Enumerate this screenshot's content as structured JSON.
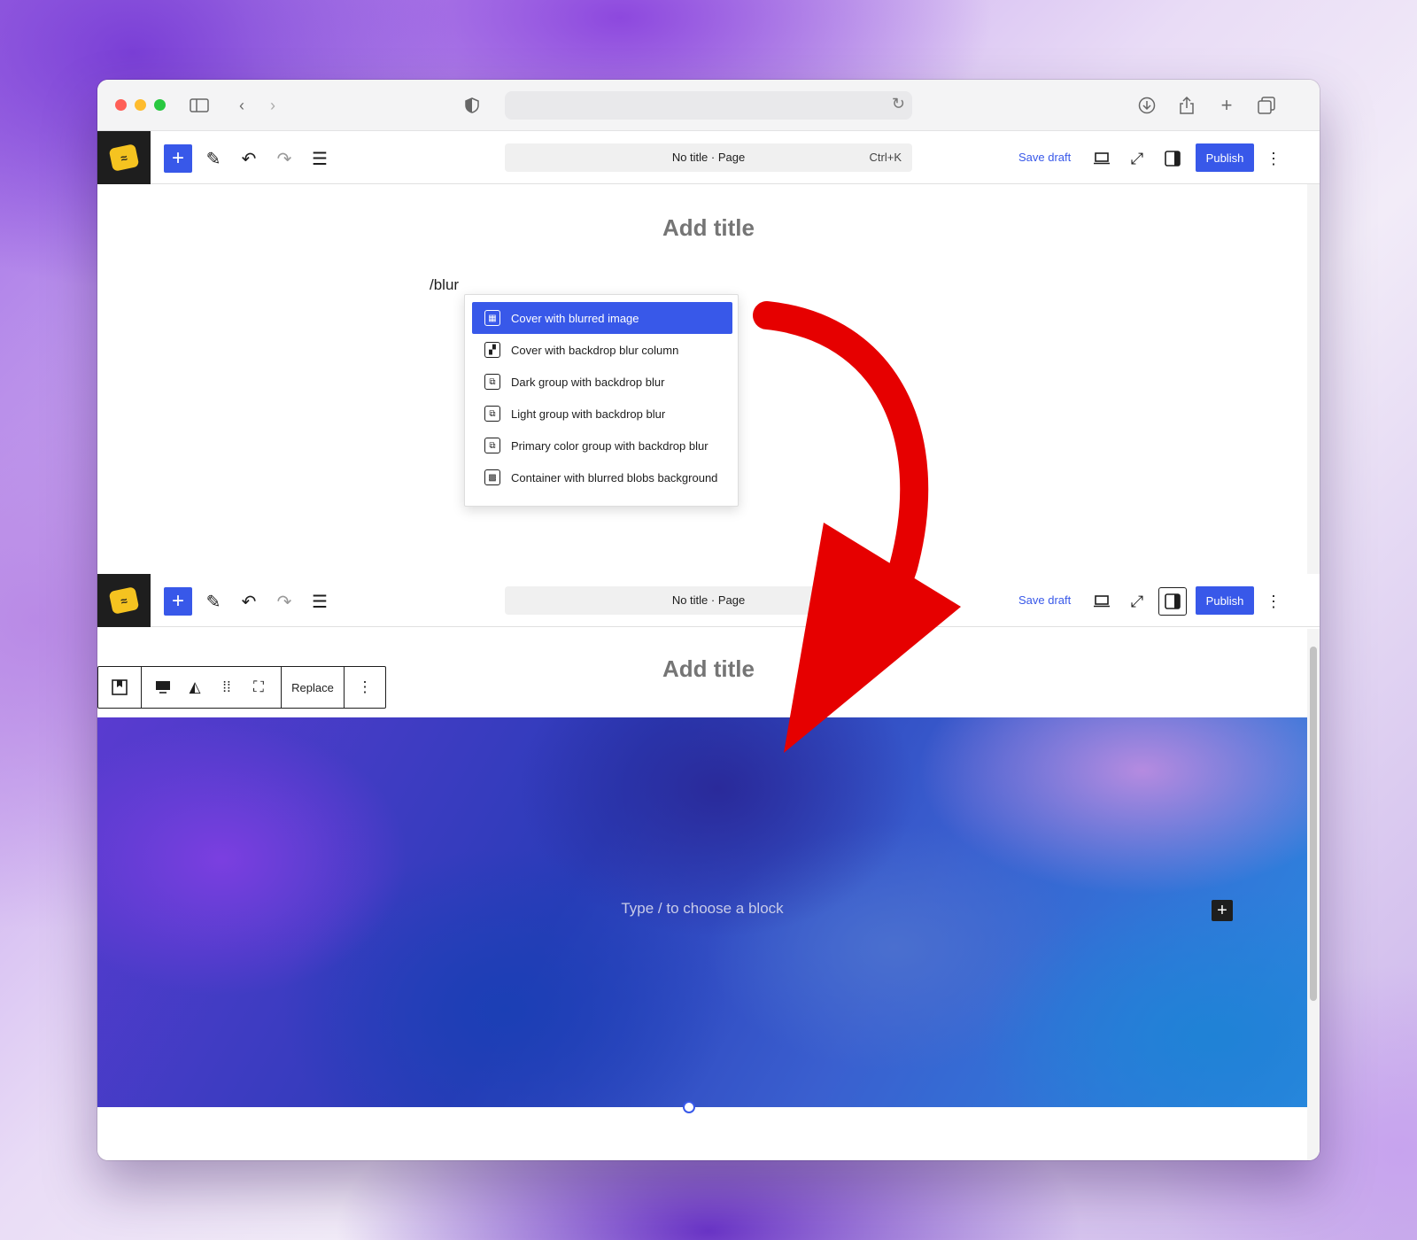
{
  "editor_top": {
    "doc_title": "No title · Page",
    "shortcut": "Ctrl+K",
    "save_draft": "Save draft",
    "publish": "Publish"
  },
  "editor_bottom": {
    "doc_title": "No title · Page",
    "save_draft": "Save draft",
    "publish": "Publish"
  },
  "canvas": {
    "title_placeholder": "Add title",
    "slash_command": "/blur"
  },
  "menu": {
    "items": [
      {
        "label": "Cover with blurred image",
        "selected": true
      },
      {
        "label": "Cover with backdrop blur column",
        "selected": false
      },
      {
        "label": "Dark group with backdrop blur",
        "selected": false
      },
      {
        "label": "Light group with backdrop blur",
        "selected": false
      },
      {
        "label": "Primary color group with backdrop blur",
        "selected": false
      },
      {
        "label": "Container with blurred blobs background",
        "selected": false
      }
    ]
  },
  "block_toolbar": {
    "replace": "Replace"
  },
  "cover_block": {
    "hint": "Type / to choose a block"
  },
  "colors": {
    "accent": "#3858e9",
    "annotation_arrow": "#e60000",
    "logo": "#f5c320"
  }
}
